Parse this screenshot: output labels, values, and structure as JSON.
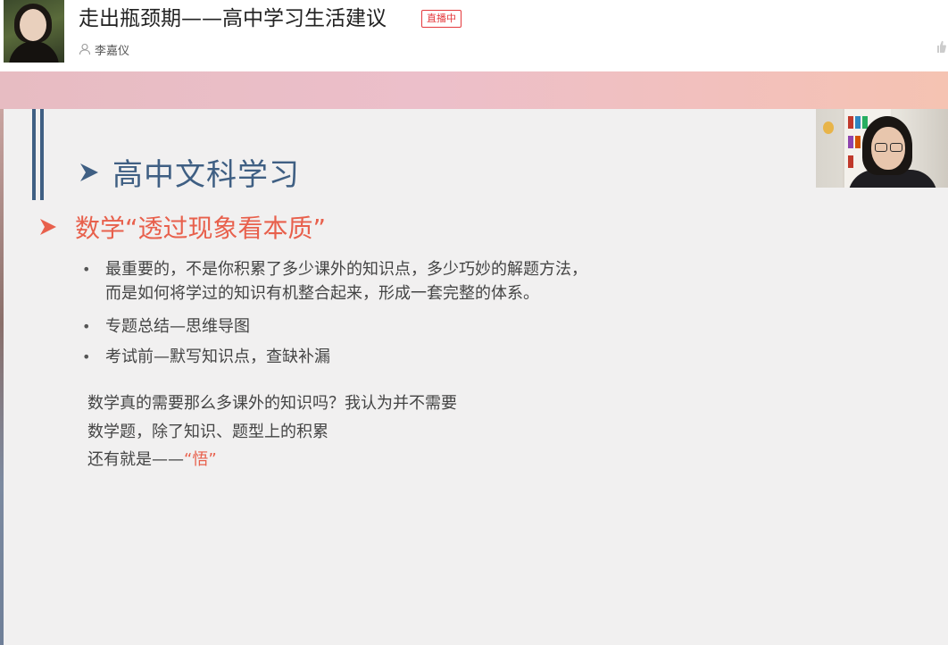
{
  "header": {
    "title": "走出瓶颈期——高中学习生活建议",
    "live_badge": "直播中",
    "host_name": "李嘉仪"
  },
  "slide": {
    "heading": "高中文科学习",
    "subheading": "数学“透过现象看本质”",
    "bullets": [
      {
        "line1": "最重要的，不是你积累了多少课外的知识点，多少巧妙的解题方法，",
        "line2": "而是如何将学过的知识有机整合起来，形成一套完整的体系。"
      },
      {
        "line1": "专题总结—思维导图"
      },
      {
        "line1": "考试前—默写知识点，查缺补漏"
      }
    ],
    "paragraphs": {
      "p1": "数学真的需要那么多课外的知识吗？我认为并不需要",
      "p2": "数学题，除了知识、题型上的积累",
      "p3_prefix": "还有就是——",
      "p3_accent": "“悟”"
    }
  },
  "bullet_glyph": "•",
  "colors": {
    "heading": "#3f5f83",
    "accent": "#e8604c",
    "live_badge": "#e4393c",
    "slide_bg": "#f1f0f0"
  },
  "icons": {
    "user": "user-icon",
    "like": "thumbs-up-icon",
    "heading_arrow": "arrowhead-icon",
    "sub_arrow": "arrowhead-icon"
  }
}
